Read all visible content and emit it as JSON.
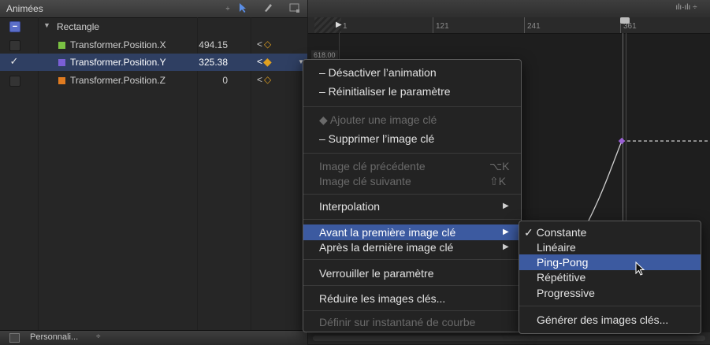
{
  "left_panel": {
    "title": "Animées",
    "header_icons": {
      "stepper": "◆",
      "arrow_tool": "▲",
      "pen_tool": "/",
      "display_menu": "▣"
    },
    "group": {
      "label": "Rectangle"
    },
    "rows": [
      {
        "label": "Transformer.Position.X",
        "value": "494.15",
        "color": "#7ac143",
        "checked": false
      },
      {
        "label": "Transformer.Position.Y",
        "value": "325.38",
        "color": "#7b5fd6",
        "checked": true
      },
      {
        "label": "Transformer.Position.Z",
        "value": "0",
        "color": "#e07b20",
        "checked": false
      }
    ],
    "footer": {
      "preset": "Personnali...",
      "stepper": "÷"
    }
  },
  "timeline": {
    "ticks": [
      "1",
      "121",
      "241",
      "361"
    ],
    "y_marker": "618.00",
    "audio_icon": "waveform-icon"
  },
  "context_menu": {
    "items": [
      {
        "label": "– Désactiver l’animation",
        "disabled": false
      },
      {
        "label": "– Réinitialiser le paramètre",
        "disabled": false
      },
      {
        "label": "◆ Ajouter une image clé",
        "disabled": true
      },
      {
        "label": "– Supprimer l’image clé",
        "disabled": false
      },
      {
        "label": "Image clé précédente",
        "shortcut": "⌥K",
        "disabled": true
      },
      {
        "label": "Image clé suivante",
        "shortcut": "⇧K",
        "disabled": true
      },
      {
        "label": "Interpolation",
        "submenu": true,
        "disabled": false
      },
      {
        "label": "Avant la première image clé",
        "submenu": true,
        "highlighted": true
      },
      {
        "label": "Après la dernière image clé",
        "submenu": true,
        "disabled": false
      },
      {
        "label": "Verrouiller le paramètre",
        "disabled": false
      },
      {
        "label": "Réduire les images clés...",
        "disabled": false
      },
      {
        "label": "Définir sur instantané de courbe",
        "disabled": true
      }
    ]
  },
  "submenu": {
    "items": [
      {
        "label": "✓ Constante",
        "checked": true
      },
      {
        "label": "Linéaire"
      },
      {
        "label": "Ping-Pong",
        "highlighted": true
      },
      {
        "label": "Répétitive"
      },
      {
        "label": "Progressive"
      },
      {
        "label": "Générer des images clés..."
      }
    ]
  },
  "colors": {
    "accent": "#3c5aa0",
    "keyframe": "#e0a020",
    "curve": "#cfcfcf",
    "curve_point": "#9a5fd6"
  }
}
